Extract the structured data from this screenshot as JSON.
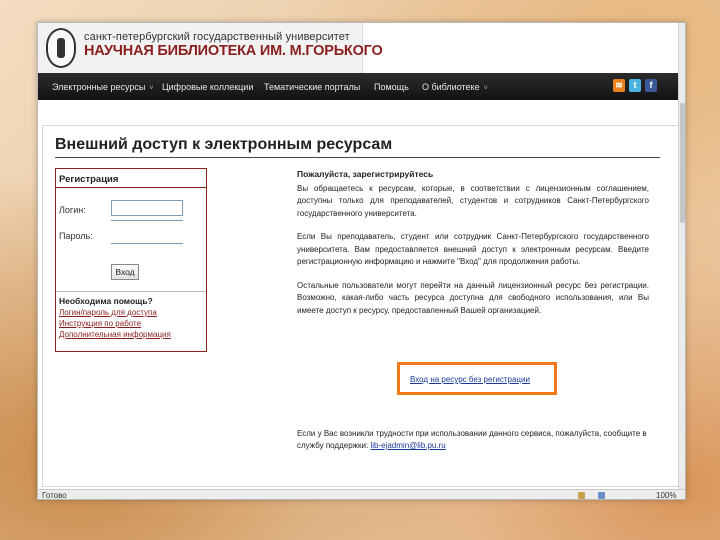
{
  "header": {
    "university": "санкт-петербургский государственный университет",
    "library": "НАУЧНАЯ БИБЛИОТЕКА ИМ. М.ГОРЬКОГО"
  },
  "nav": {
    "items": [
      {
        "label": "Электронные ресурсы",
        "caret": "˅"
      },
      {
        "label": "Цифровые коллекции",
        "caret": ""
      },
      {
        "label": "Тематические порталы",
        "caret": ""
      },
      {
        "label": "Помощь",
        "caret": ""
      },
      {
        "label": "О библиотеке",
        "caret": "˅"
      }
    ],
    "social": [
      "rss-icon",
      "twitter-icon",
      "facebook-icon"
    ]
  },
  "page": {
    "title": "Внешний доступ к электронным ресурсам"
  },
  "login": {
    "heading": "Регистрация",
    "login_label": "Логин:",
    "password_label": "Пароль:",
    "submit": "Вход",
    "help_title": "Необходима помощь?",
    "help_links": [
      "Логин/пароль для доступа",
      "Инструкция по работе",
      "Дополнительная информация"
    ]
  },
  "info": {
    "title": "Пожалуйста, зарегистрируйтесь",
    "p1": "Вы обращаетесь к ресурсам, которые, в соответствии с лицензионным соглашением, доступны только для преподавателей, студентов и сотрудников Санкт-Петербургского государственного университета.",
    "p2": "Если Вы преподаватель, студент или сотрудник Санкт-Петербургского государственного университета. Вам предоставляется внешний доступ к электронным ресурсам. Введите регистрационную информацию и нажмите \"Вход\" для продолжения работы.",
    "p3": "Остальные пользователи могут перейти на данный лицензионный ресурс без регистрации. Возможно, какая-либо часть ресурса доступна для свободного использования, или Вы имеете доступ к ресурсу, предоставленный Вашей организацией.",
    "guest_link": "Вход на ресурс без регистрации",
    "contact_text": "Если у Вас возникли трудности при использовании данного сервиса, пожалуйста, сообщите в службу поддержки:",
    "contact_email": "lib-ejadmin@lib.pu.ru"
  },
  "status": {
    "left": "Готово",
    "zoom": "100%"
  },
  "colors": {
    "accent_red": "#8b1e1e",
    "nav_bg": "#1e1e1e",
    "highlight_orange": "#ef7a1a",
    "link_blue": "#1a3a9b"
  }
}
